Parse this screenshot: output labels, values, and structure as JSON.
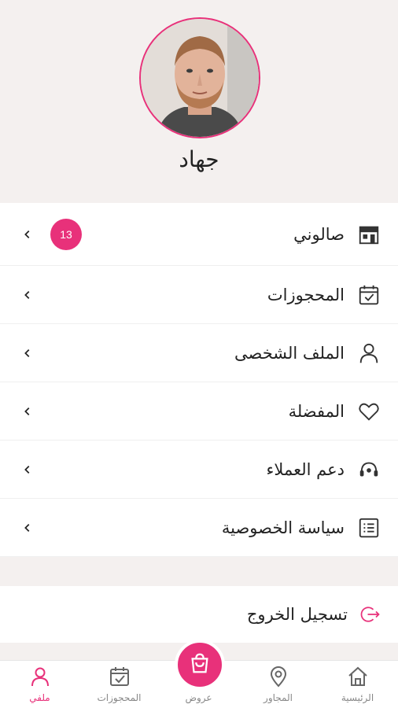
{
  "profile": {
    "name": "جهاد"
  },
  "menu": {
    "items": [
      {
        "label": "صالوني",
        "icon": "salon-icon",
        "badge": "13"
      },
      {
        "label": "المحجوزات",
        "icon": "calendar-check-icon"
      },
      {
        "label": "الملف الشخصى",
        "icon": "user-icon"
      },
      {
        "label": "المفضلة",
        "icon": "heart-icon"
      },
      {
        "label": "دعم العملاء",
        "icon": "headset-icon"
      },
      {
        "label": "سياسة الخصوصية",
        "icon": "list-icon"
      }
    ]
  },
  "logout": {
    "label": "تسجيل الخروج",
    "icon": "logout-icon"
  },
  "bottom_nav": {
    "items": [
      {
        "label": "ملفي",
        "icon": "user-icon",
        "active": true
      },
      {
        "label": "المحجوزات",
        "icon": "calendar-check-icon"
      },
      {
        "label": "عروض",
        "icon": "shopping-bag-icon"
      },
      {
        "label": "المجاور",
        "icon": "location-pin-icon"
      },
      {
        "label": "الرئيسية",
        "icon": "home-icon"
      }
    ]
  },
  "colors": {
    "accent": "#e8317a",
    "background": "#f4f0ef"
  }
}
